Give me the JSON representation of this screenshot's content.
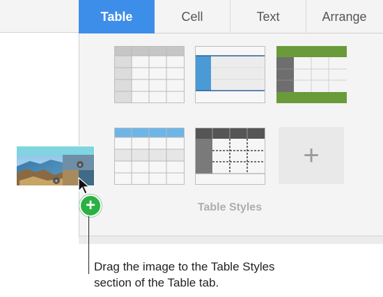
{
  "tabs": [
    {
      "label": "Table",
      "active": true
    },
    {
      "label": "Cell",
      "active": false
    },
    {
      "label": "Text",
      "active": false
    },
    {
      "label": "Arrange",
      "active": false
    }
  ],
  "table_styles": {
    "section_label": "Table Styles",
    "styles": [
      {
        "name": "gray-header-style",
        "accent": "#c4c4c4"
      },
      {
        "name": "blue-left-column-style",
        "accent": "#4a9ad6"
      },
      {
        "name": "green-border-style",
        "accent": "#6a9b3a"
      },
      {
        "name": "light-blue-header-style",
        "accent": "#6eb5e6"
      },
      {
        "name": "dark-dashed-style",
        "accent": "#555555"
      }
    ],
    "add_icon": "plus-icon"
  },
  "drag": {
    "badge_icon": "plus-icon",
    "badge_color": "#2bb043"
  },
  "callout": {
    "text_line1": "Drag the image to the Table Styles",
    "text_line2": "section of the Table tab."
  },
  "colors": {
    "active_tab": "#3d8ee9"
  }
}
